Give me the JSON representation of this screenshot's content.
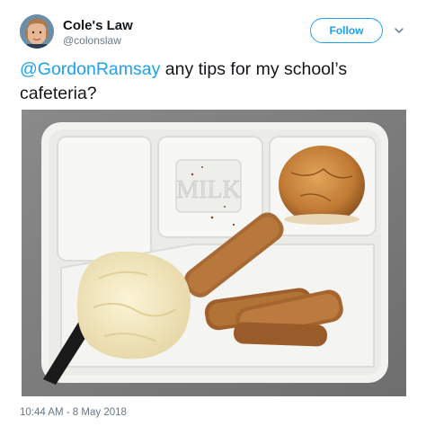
{
  "header": {
    "display_name": "Cole's Law",
    "handle": "@colonslaw",
    "follow_label": "Follow",
    "menu_icon": "chevron-down-icon"
  },
  "tweet": {
    "mention": "@GordonRamsay",
    "text": " any tips for my school’s cafeteria?"
  },
  "photo": {
    "tray_text": "MILK"
  },
  "footer": {
    "timestamp": "10:44 AM - 8 May 2018"
  },
  "colors": {
    "accent": "#1da1f2",
    "secondary_text": "#657786"
  }
}
